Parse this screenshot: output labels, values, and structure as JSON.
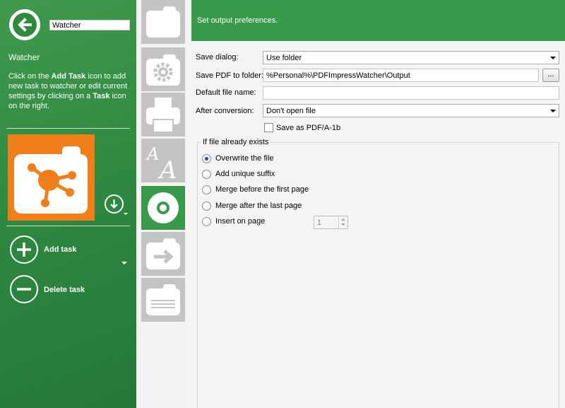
{
  "sidebar": {
    "watcher_name_value": "Watcher",
    "watcher_title": "Watcher",
    "instructions": {
      "part1": "Click on the ",
      "bold1": "Add Task",
      "part2": " icon to add new task to watcher or edit current settings by clicking on a ",
      "bold2": "Task",
      "part3": " icon on the right."
    },
    "add_task_label": "Add task",
    "delete_task_label": "Delete task",
    "task_tile_color": "#f07f1b"
  },
  "nav": {
    "items": [
      {
        "icon": "folder-icon",
        "active": false
      },
      {
        "icon": "gear-icon",
        "active": false
      },
      {
        "icon": "printer-icon",
        "active": false
      },
      {
        "icon": "font-icon",
        "active": false
      },
      {
        "icon": "disc-icon",
        "active": true
      },
      {
        "icon": "export-arrow-icon",
        "active": false
      },
      {
        "icon": "document-icon",
        "active": false
      }
    ],
    "active_color": "#3a9a4c"
  },
  "header": {
    "description": "Set output preferences."
  },
  "form": {
    "save_dialog_label": "Save dialog:",
    "save_dialog_value": "Use folder",
    "save_pdf_label": "Save PDF to folder:",
    "save_pdf_value": "%Personal%\\PDFImpressWatcher\\Output",
    "browse_label": "...",
    "default_file_label": "Default file name:",
    "default_file_value": "",
    "after_conversion_label": "After conversion:",
    "after_conversion_value": "Don't open file",
    "pdfa_label": "Save as PDF/A-1b",
    "pdfa_checked": false
  },
  "if_exists": {
    "title": "If file already exists",
    "options": [
      {
        "label": "Overwrite the file",
        "checked": true
      },
      {
        "label": "Add unique suffix",
        "checked": false
      },
      {
        "label": "Merge before the first page",
        "checked": false
      },
      {
        "label": "Merge after the last page",
        "checked": false
      },
      {
        "label": "Insert on page",
        "checked": false
      }
    ],
    "insert_page_value": "1"
  }
}
